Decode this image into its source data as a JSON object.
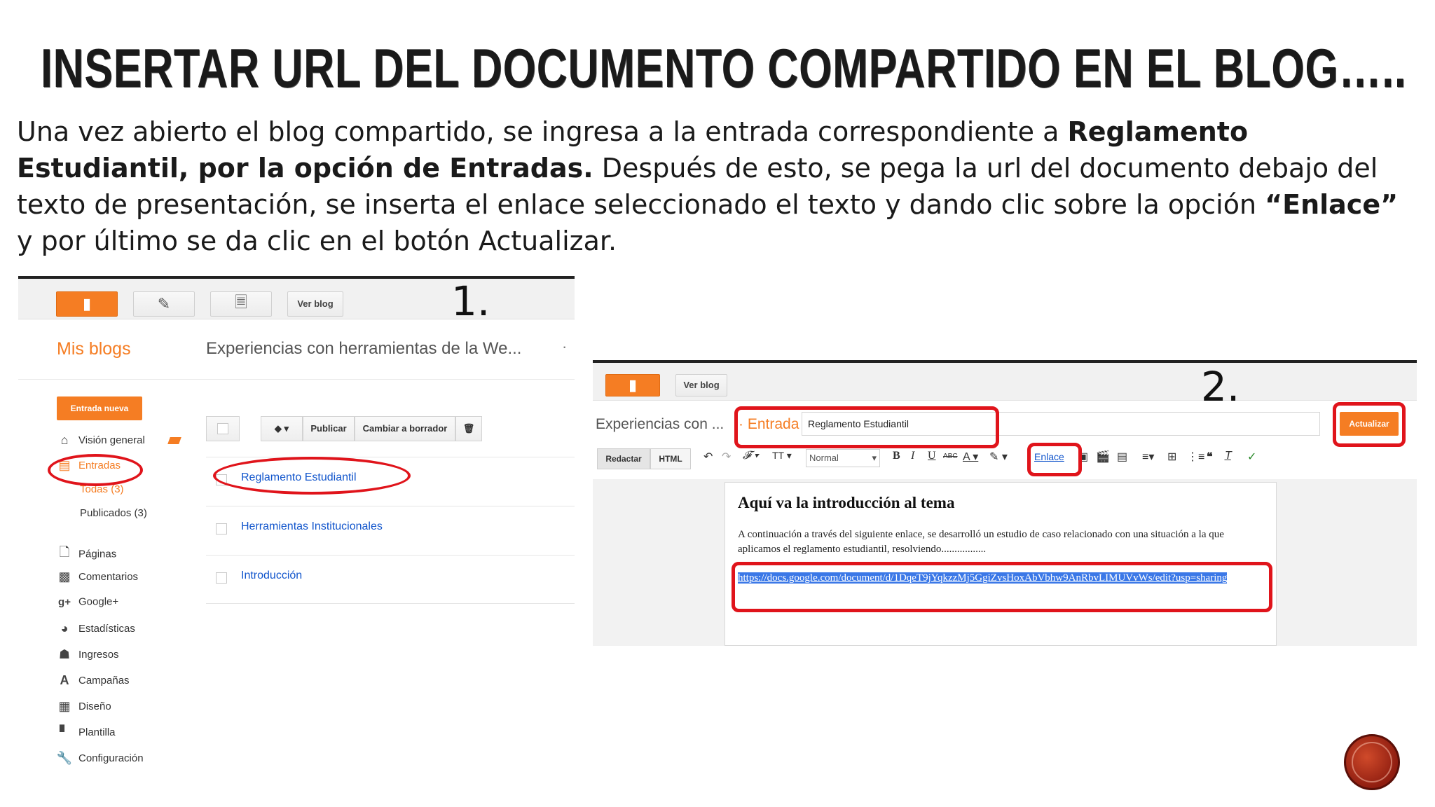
{
  "slide": {
    "title": "INSERTAR URL DEL DOCUMENTO COMPARTIDO EN EL BLOG…..",
    "para_1": "Una vez abierto el blog compartido, se ingresa a la entrada correspondiente a ",
    "para_bold_1": "Reglamento Estudiantil, por la opción de Entradas.",
    "para_2": " Después de esto, se pega la url del documento debajo del texto de presentación, se inserta el enlace seleccionado el texto y dando clic sobre la opción ",
    "para_bold_2": "“Enlace”",
    "para_3": " y  por último se da clic en el botón Actualizar."
  },
  "shot1": {
    "step": "1.",
    "ver_blog": "Ver blog",
    "mis_blogs": "Mis blogs",
    "blog_name": "Experiencias con herramientas de la We...",
    "hdr_dot": "·",
    "new_post": "Entrada nueva",
    "nav": {
      "overview": "Visión general",
      "posts": "Entradas",
      "all": "Todas (3)",
      "published": "Publicados (3)",
      "pages": "Páginas",
      "comments": "Comentarios",
      "gplus": "Google+",
      "stats": "Estadísticas",
      "earnings": "Ingresos",
      "campaigns": "Campañas",
      "design": "Diseño",
      "template": "Plantilla",
      "settings": "Configuración"
    },
    "toolbar": {
      "publish": "Publicar",
      "revert": "Cambiar a borrador"
    },
    "posts": [
      "Reglamento Estudiantil",
      "Herramientas Institucionales",
      "Introducción"
    ]
  },
  "shot2": {
    "step": "2.",
    "ver_blog": "Ver blog",
    "blog_name": "Experiencias con ...",
    "entrada": "· Entrada",
    "post_title": "Reglamento Estudiantil",
    "update": "Actualizar",
    "tab_compose": "Redactar",
    "tab_html": "HTML",
    "font_size": "Normal",
    "link_tool": "Enlace",
    "heading": "Aquí va la introducción al tema",
    "body": "A continuación a través del siguiente enlace, se desarrolló un estudio de caso relacionado con una situación a la que aplicamos el reglamento estudiantil, resolviendo.................",
    "url": "https://docs.google.com/document/d/1DqeT9jYqkzzMj5GgiZvsHoxAbVbhw9AnRbvLIMUVvWs/edit?usp=sharing"
  },
  "colors": {
    "accent": "#f57d23",
    "annotation": "#e0141b",
    "link": "#1155cc"
  }
}
